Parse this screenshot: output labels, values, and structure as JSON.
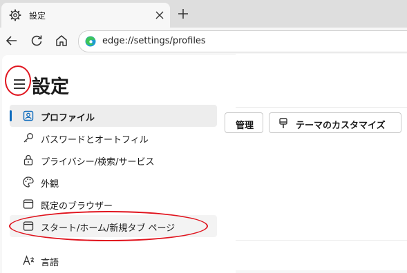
{
  "tab": {
    "title": "設定"
  },
  "address_bar": {
    "url": "edge://settings/profiles"
  },
  "page": {
    "title": "設定"
  },
  "sidebar": {
    "items": [
      {
        "label": "プロファイル",
        "icon": "profile-icon",
        "active": true
      },
      {
        "label": "パスワードとオートフィル",
        "icon": "key-icon"
      },
      {
        "label": "プライバシー/検索/サービス",
        "icon": "lock-icon"
      },
      {
        "label": "外観",
        "icon": "palette-icon"
      },
      {
        "label": "既定のブラウザー",
        "icon": "browser-window-icon"
      },
      {
        "label": "スタート/ホーム/新規タブ ページ",
        "icon": "home-page-icon"
      },
      {
        "label": "言語",
        "icon": "language-icon"
      }
    ]
  },
  "main": {
    "manage_button": "管理",
    "customize_theme_button": "テーマのカスタマイズ"
  },
  "colors": {
    "accent": "#0f6cbd",
    "annotation": "#e0141e"
  }
}
